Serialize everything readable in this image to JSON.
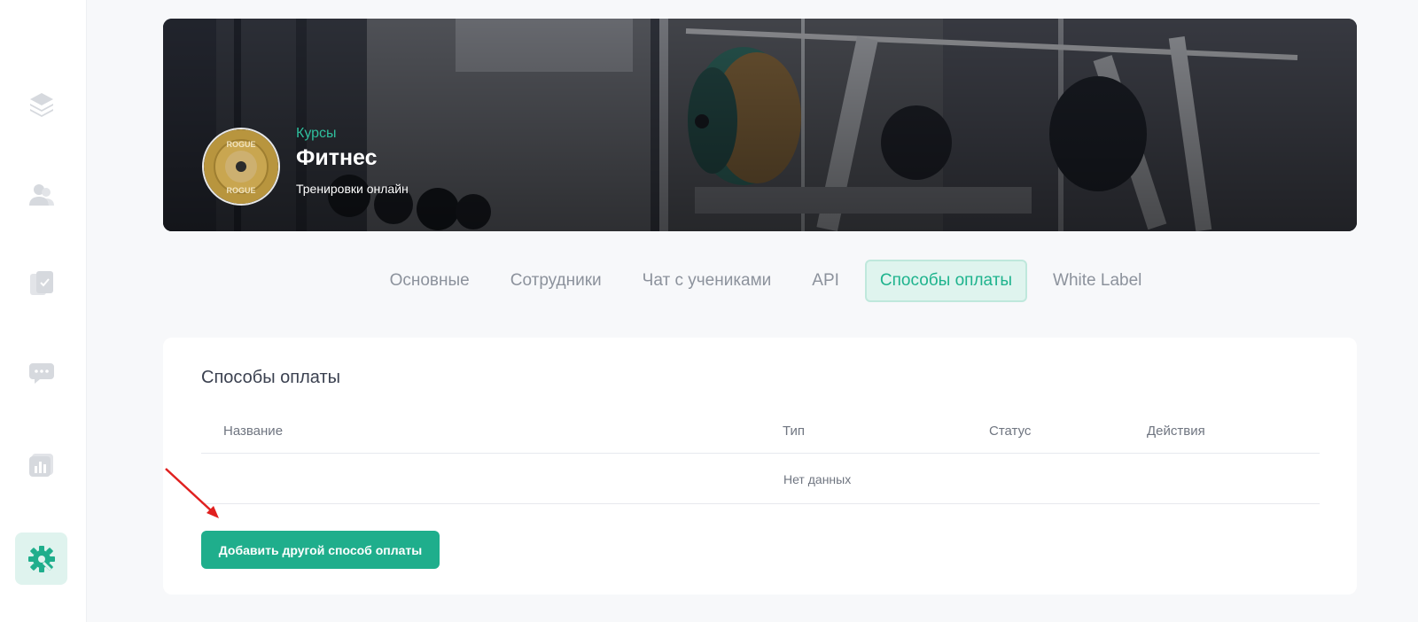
{
  "sidebar": {
    "items": [
      {
        "icon": "layers-icon",
        "active": false
      },
      {
        "icon": "users-icon",
        "active": false
      },
      {
        "icon": "documents-icon",
        "active": false
      },
      {
        "icon": "chat-icon",
        "active": false
      },
      {
        "icon": "stats-icon",
        "active": false
      },
      {
        "icon": "settings-icon",
        "active": true
      }
    ]
  },
  "banner": {
    "category": "Курсы",
    "title": "Фитнес",
    "subtitle": "Тренировки онлайн",
    "avatar_text_top": "ROGUE",
    "avatar_text_bottom": "ROGUE"
  },
  "tabs": [
    {
      "label": "Основные",
      "active": false
    },
    {
      "label": "Сотрудники",
      "active": false
    },
    {
      "label": "Чат с учениками",
      "active": false
    },
    {
      "label": "API",
      "active": false
    },
    {
      "label": "Способы оплаты",
      "active": true
    },
    {
      "label": "White Label",
      "active": false
    }
  ],
  "payments": {
    "title": "Способы оплаты",
    "columns": [
      "Название",
      "Тип",
      "Статус",
      "Действия"
    ],
    "empty_text": "Нет данных",
    "add_button": "Добавить другой способ оплаты"
  },
  "colors": {
    "accent": "#1fae8c",
    "accent_light": "#dff4ee",
    "annotation_arrow": "#e0201f"
  }
}
